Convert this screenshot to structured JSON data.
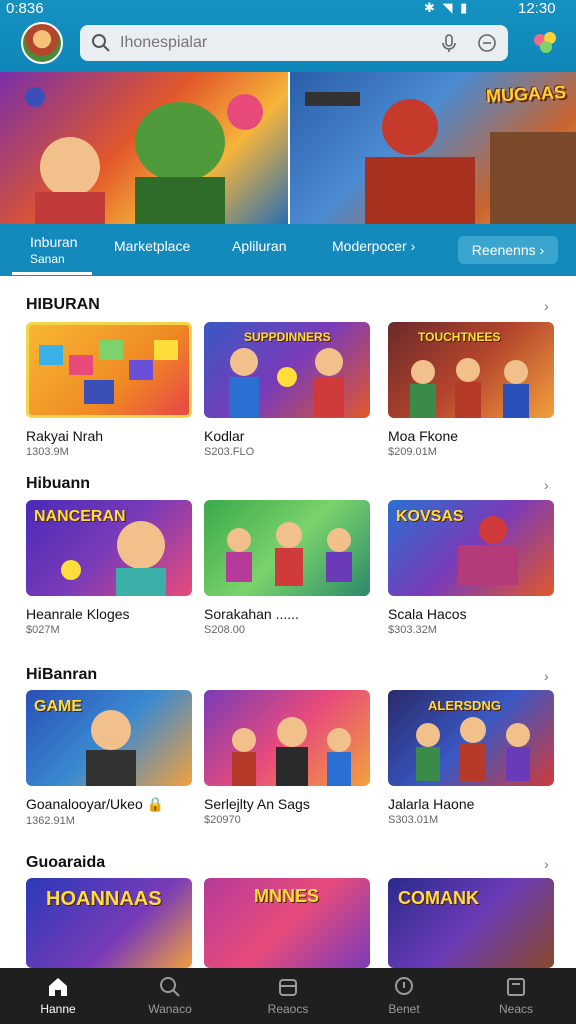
{
  "status": {
    "time": "0:836",
    "icons": "✱ ◥ ▮",
    "clock": "12:30"
  },
  "search": {
    "placeholder": "Ihonespialar"
  },
  "banner": {
    "right_title": "MUGAAS"
  },
  "tabs": [
    {
      "label": "Inburan",
      "sub": "Sanan"
    },
    {
      "label": "Marketplace"
    },
    {
      "label": "Apliluran"
    },
    {
      "label": "Moderpocer ›"
    },
    {
      "label": "Reenenns ›"
    }
  ],
  "sections": [
    {
      "title": "HIBURAN",
      "chev": "›",
      "cards": [
        {
          "name": "Rakyai Nrah",
          "size": "1303.9M",
          "label": ""
        },
        {
          "name": "Kodlar",
          "size": "S203.FLO",
          "label": "SUPPDINNERS"
        },
        {
          "name": "Moa Fkone",
          "size": "$209.01M",
          "label": "TOUCHTNEES"
        }
      ]
    },
    {
      "title": "Hibuann",
      "chev": "›",
      "cards": [
        {
          "name": "Heanrale Kloges",
          "size": "$027M",
          "label": "NANCERAN"
        },
        {
          "name": "Sorakahan ......",
          "size": "S208.00",
          "label": ""
        },
        {
          "name": "Scala Hacos",
          "size": "$303.32M",
          "label": "KOVSAS"
        }
      ]
    },
    {
      "title": "HiBanran",
      "chev": "›",
      "cards": [
        {
          "name": "Goanalooyar/Ukeo 🔒",
          "size": "1362.91M",
          "label": "GAME"
        },
        {
          "name": "Serlejlty An Sags",
          "size": "$20970",
          "label": ""
        },
        {
          "name": "Jalarla Haone",
          "size": "S303.01M",
          "label": "ALERSDNG"
        }
      ]
    },
    {
      "title": "Guoaraida",
      "chev": "›",
      "cards": [
        {
          "name": "",
          "size": "",
          "label": "HOANNAAS"
        },
        {
          "name": "",
          "size": "",
          "label": "MNNES"
        },
        {
          "name": "",
          "size": "",
          "label": "COMANK"
        }
      ]
    }
  ],
  "nav": [
    {
      "label": "Hanne"
    },
    {
      "label": "Wanaco"
    },
    {
      "label": "Reaocs"
    },
    {
      "label": "Benet"
    },
    {
      "label": "Neacs"
    }
  ]
}
